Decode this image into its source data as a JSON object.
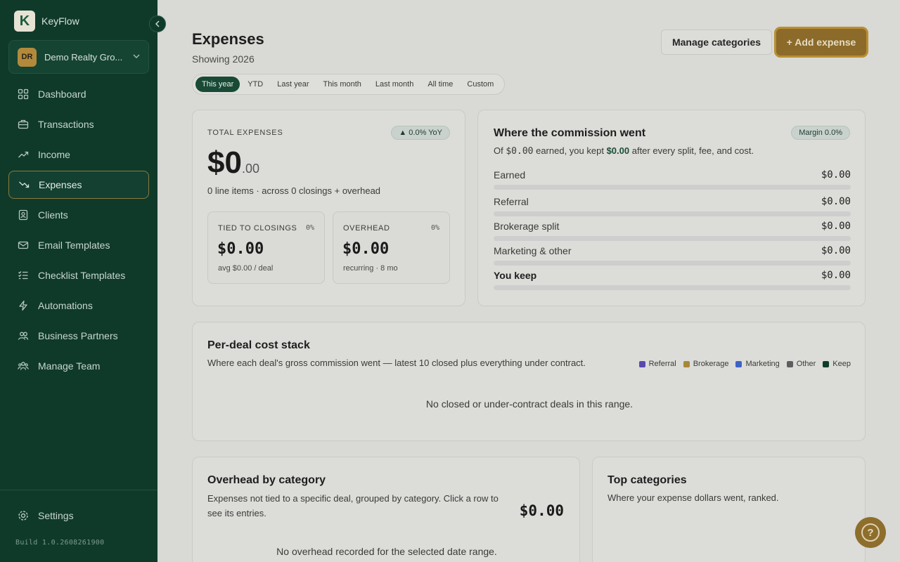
{
  "app": {
    "name": "KeyFlow",
    "logo_letter": "K"
  },
  "org": {
    "initials": "DR",
    "name": "Demo Realty Gro..."
  },
  "nav": [
    {
      "label": "Dashboard",
      "icon": "grid-icon",
      "active": false
    },
    {
      "label": "Transactions",
      "icon": "briefcase-icon",
      "active": false
    },
    {
      "label": "Income",
      "icon": "trend-up-icon",
      "active": false
    },
    {
      "label": "Expenses",
      "icon": "trend-down-icon",
      "active": true
    },
    {
      "label": "Clients",
      "icon": "contacts-icon",
      "active": false
    },
    {
      "label": "Email Templates",
      "icon": "mail-icon",
      "active": false
    },
    {
      "label": "Checklist Templates",
      "icon": "checklist-icon",
      "active": false
    },
    {
      "label": "Automations",
      "icon": "bolt-icon",
      "active": false
    },
    {
      "label": "Business Partners",
      "icon": "users-icon",
      "active": false
    },
    {
      "label": "Manage Team",
      "icon": "team-icon",
      "active": false
    }
  ],
  "settings_label": "Settings",
  "build": "Build 1.0.2608261900",
  "header": {
    "title": "Expenses",
    "subtitle": "Showing 2026",
    "manage_label": "Manage categories",
    "add_label": "+ Add expense"
  },
  "ranges": [
    "This year",
    "YTD",
    "Last year",
    "This month",
    "Last month",
    "All time",
    "Custom"
  ],
  "active_range": "This year",
  "total": {
    "label": "TOTAL EXPENSES",
    "yoy": "▲ 0.0% YoY",
    "amount": "$0",
    "cents": ".00",
    "desc": "0 line items · across 0 closings + overhead",
    "tied": {
      "label": "TIED TO CLOSINGS",
      "pct": "0%",
      "amount": "$0.00",
      "note": "avg $0.00 / deal"
    },
    "overhead": {
      "label": "OVERHEAD",
      "pct": "0%",
      "amount": "$0.00",
      "note": "recurring · 8 mo"
    }
  },
  "commission": {
    "title": "Where the commission went",
    "margin": "Margin 0.0%",
    "desc_prefix": "Of ",
    "desc_earned": "$0.00",
    "desc_mid": " earned, you kept ",
    "desc_kept": "$0.00",
    "desc_suffix": " after every split, fee, and cost.",
    "rows": [
      {
        "label": "Earned",
        "value": "$0.00"
      },
      {
        "label": "Referral",
        "value": "$0.00"
      },
      {
        "label": "Brokerage split",
        "value": "$0.00"
      },
      {
        "label": "Marketing & other",
        "value": "$0.00"
      },
      {
        "label": "You keep",
        "value": "$0.00"
      }
    ]
  },
  "per_deal": {
    "title": "Per-deal cost stack",
    "desc": "Where each deal's gross commission went — latest 10 closed plus everything under contract.",
    "legend": [
      {
        "label": "Referral",
        "color": "#5b49b0"
      },
      {
        "label": "Brokerage",
        "color": "#a8873a"
      },
      {
        "label": "Marketing",
        "color": "#3e63c4"
      },
      {
        "label": "Other",
        "color": "#5e5e5e"
      },
      {
        "label": "Keep",
        "color": "#0f3d2b"
      }
    ],
    "empty": "No closed or under-contract deals in this range."
  },
  "overhead_card": {
    "title": "Overhead by category",
    "desc": "Expenses not tied to a specific deal, grouped by category. Click a row to see its entries.",
    "amount": "$0.00",
    "empty": "No overhead recorded for the selected date range."
  },
  "top_categories": {
    "title": "Top categories",
    "desc": "Where your expense dollars went, ranked."
  },
  "help_label": "?"
}
